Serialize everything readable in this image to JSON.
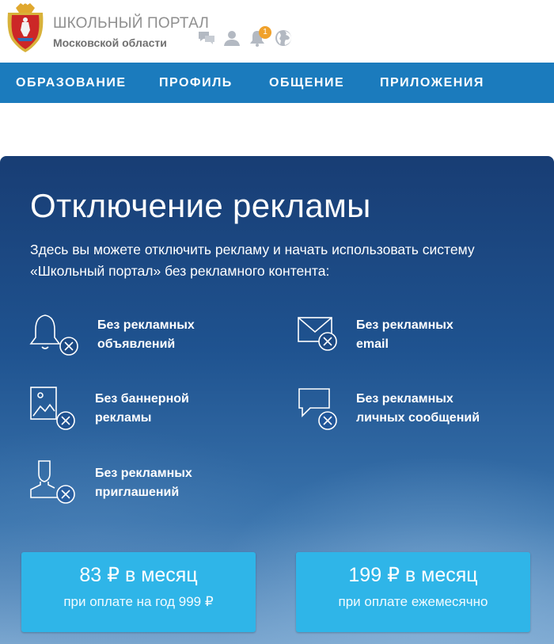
{
  "header": {
    "brand_title": "ШКОЛЬНЫЙ ПОРТАЛ",
    "brand_subtitle": "Московской области",
    "notification_count": "1",
    "icons": [
      "chat-icon",
      "user-icon",
      "bell-icon",
      "globe-icon"
    ]
  },
  "nav": {
    "items": [
      {
        "label": "ОБРАЗОВАНИЕ"
      },
      {
        "label": "ПРОФИЛЬ"
      },
      {
        "label": "ОБЩЕНИЕ"
      },
      {
        "label": "ПРИЛОЖЕНИЯ"
      }
    ]
  },
  "hero": {
    "title": "Отключение рекламы",
    "description": "Здесь вы можете отключить рекламу и начать использовать систему «Школьный портал» без рекламного контента:"
  },
  "features": [
    {
      "line1": "Без рекламных",
      "line2": "объявлений",
      "icon": "bell-off-icon"
    },
    {
      "line1": "Без рекламных",
      "line2": "email",
      "icon": "mail-off-icon"
    },
    {
      "line1": "Без баннерной",
      "line2": "рекламы",
      "icon": "image-off-icon"
    },
    {
      "line1": "Без рекламных",
      "line2": "личных сообщений",
      "icon": "message-off-icon"
    },
    {
      "line1": "Без рекламных",
      "line2": "приглашений",
      "icon": "person-off-icon"
    }
  ],
  "pricing": [
    {
      "price": "83 ₽ в месяц",
      "note": "при оплате на год 999 ₽"
    },
    {
      "price": "199 ₽ в месяц",
      "note": "при оплате ежемесячно"
    }
  ],
  "colors": {
    "nav": "#1b7bbd",
    "button": "#2fb5e8",
    "badge": "#f0a12b",
    "hero_dark": "#183d74"
  }
}
